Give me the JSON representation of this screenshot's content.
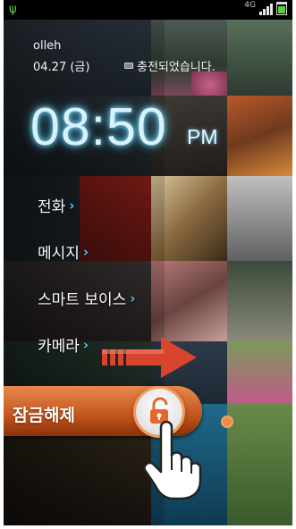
{
  "status_bar": {
    "usb_icon": "usb-icon",
    "network_type": "4G",
    "signal_icon": "signal-bars-icon",
    "battery_icon": "battery-icon"
  },
  "lockscreen": {
    "carrier": "olleh",
    "date": "04.27 (금)",
    "charging_text": "충전되었습니다.",
    "charging_icon": "battery-charging-icon",
    "time": "08:50",
    "ampm": "PM",
    "shortcuts": [
      {
        "label": "전화",
        "icon": "chevron-right-icon"
      },
      {
        "label": "메시지",
        "icon": "chevron-right-icon"
      },
      {
        "label": "스마트 보이스",
        "icon": "chevron-right-icon"
      },
      {
        "label": "카메라",
        "icon": "chevron-right-icon"
      }
    ],
    "unlock_label": "잠금해제",
    "lock_icon": "unlocked-padlock-icon",
    "swipe_hint_icon": "red-arrow-right-icon",
    "hand_icon": "pointing-hand-icon"
  },
  "colors": {
    "clock_glow": "#46c6ff",
    "unlock_bar": "#c2541c",
    "chevron": "#5ac8ff",
    "arrow": "#d9452c"
  }
}
